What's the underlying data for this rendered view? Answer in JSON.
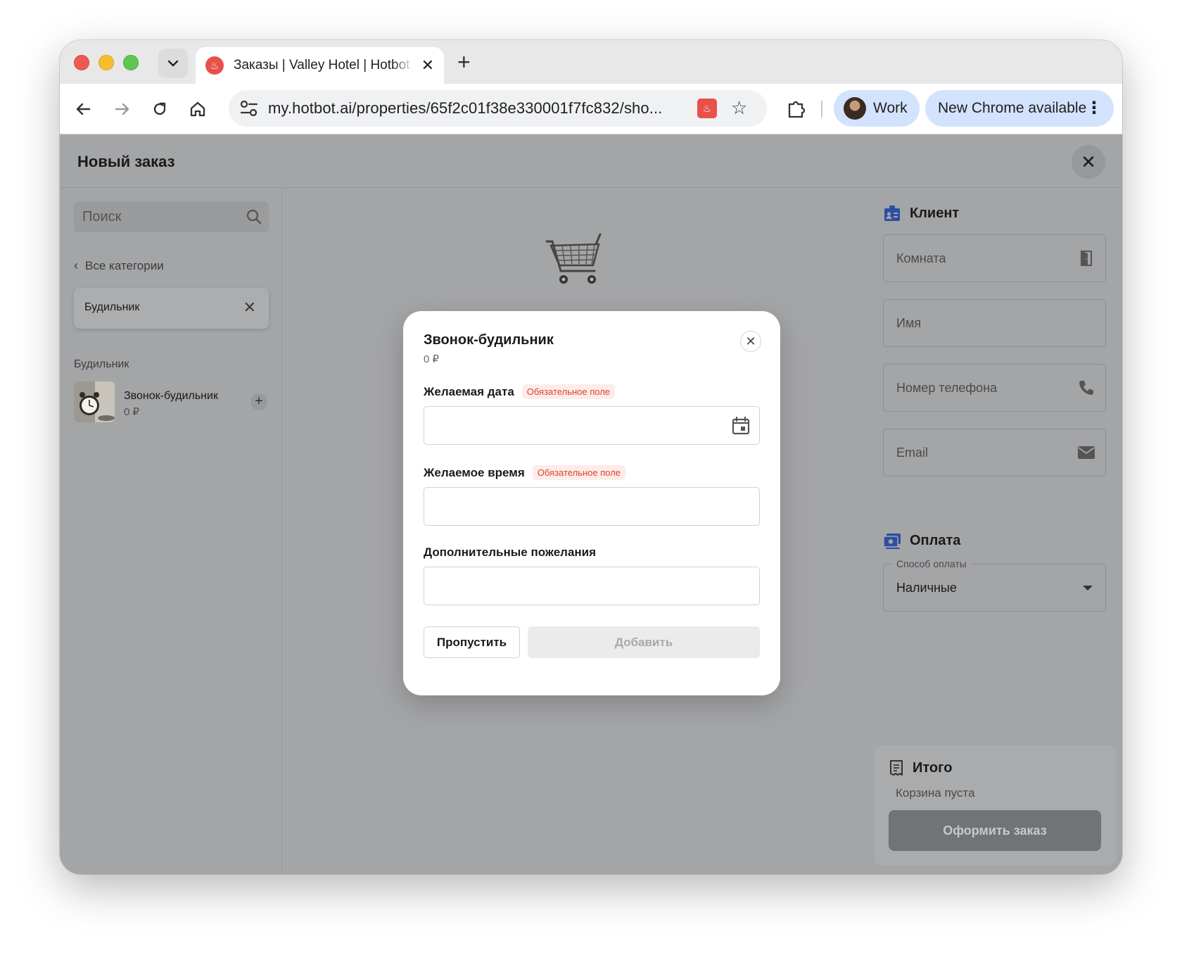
{
  "browser": {
    "tab_title": "Заказы | Valley Hotel | Hotbot",
    "tab_close": "✕",
    "new_tab": "+",
    "url": "my.hotbot.ai/properties/65f2c01f38e330001f7fc832/sho...",
    "profile_name": "Work",
    "update_label": "New Chrome available",
    "update_menu": "⋮",
    "icons": [
      "back-arrow-icon",
      "forward-arrow-icon",
      "reload-icon",
      "home-icon",
      "site-settings-icon",
      "extension-icon",
      "star-icon",
      "puzzle-icon"
    ]
  },
  "app": {
    "title": "Новый заказ",
    "close": "✕",
    "search_placeholder": "Поиск",
    "back_label": "Все категории",
    "back_chevron": "‹",
    "chip_label": "Будильник",
    "chip_close": "✕",
    "section_label": "Будильник",
    "item": {
      "name": "Звонок-будильник",
      "price": "0 ₽",
      "add": "+"
    }
  },
  "client": {
    "title": "Клиент",
    "room_placeholder": "Комната",
    "name_placeholder": "Имя",
    "phone_placeholder": "Номер телефона",
    "email_placeholder": "Email"
  },
  "payment": {
    "title": "Оплата",
    "method_label": "Способ оплаты",
    "method_value": "Наличные"
  },
  "summary": {
    "title": "Итого",
    "empty": "Корзина пуста",
    "checkout": "Оформить заказ"
  },
  "modal": {
    "title": "Звонок-будильник",
    "price": "0 ₽",
    "close": "✕",
    "date_label": "Желаемая дата",
    "time_label": "Желаемое время",
    "notes_label": "Дополнительные пожелания",
    "required_badge": "Обязательное поле",
    "skip": "Пропустить",
    "add": "Добавить"
  },
  "colors": {
    "overlay": "#a4a5a7",
    "accent_blue": "#2d4fa3",
    "required_red": "#d9452b",
    "brand_red": "#e8514a"
  }
}
